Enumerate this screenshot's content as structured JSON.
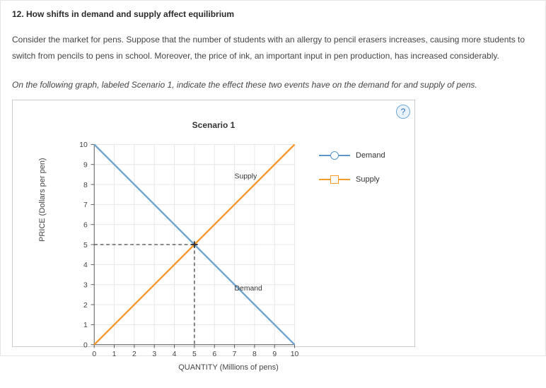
{
  "question": {
    "title": "12. How shifts in demand and supply affect equilibrium",
    "body": "Consider the market for pens. Suppose that the number of students with an allergy to pencil erasers increases, causing more students to switch from pencils to pens in school. Moreover, the price of ink, an important input in pen production, has increased considerably.",
    "instruction": "On the following graph, labeled Scenario 1, indicate the effect these two events have on the demand for and supply of pens."
  },
  "help_label": "?",
  "legend": {
    "demand": "Demand",
    "supply": "Supply"
  },
  "chart_data": {
    "type": "line",
    "title": "Scenario 1",
    "xlabel": "QUANTITY (Millions of pens)",
    "ylabel": "PRICE (Dollars per pen)",
    "xlim": [
      0,
      10
    ],
    "ylim": [
      0,
      10
    ],
    "xticks": [
      0,
      1,
      2,
      3,
      4,
      5,
      6,
      7,
      8,
      9,
      10
    ],
    "yticks": [
      0,
      1,
      2,
      3,
      4,
      5,
      6,
      7,
      8,
      9,
      10
    ],
    "series": [
      {
        "name": "Demand",
        "x": [
          0,
          10
        ],
        "y": [
          10,
          0
        ],
        "label_pos": {
          "x": 7,
          "y": 2.7
        }
      },
      {
        "name": "Supply",
        "x": [
          0,
          10
        ],
        "y": [
          0,
          10
        ],
        "label_pos": {
          "x": 7,
          "y": 8.3
        }
      }
    ],
    "equilibrium": {
      "x": 5,
      "y": 5
    }
  }
}
